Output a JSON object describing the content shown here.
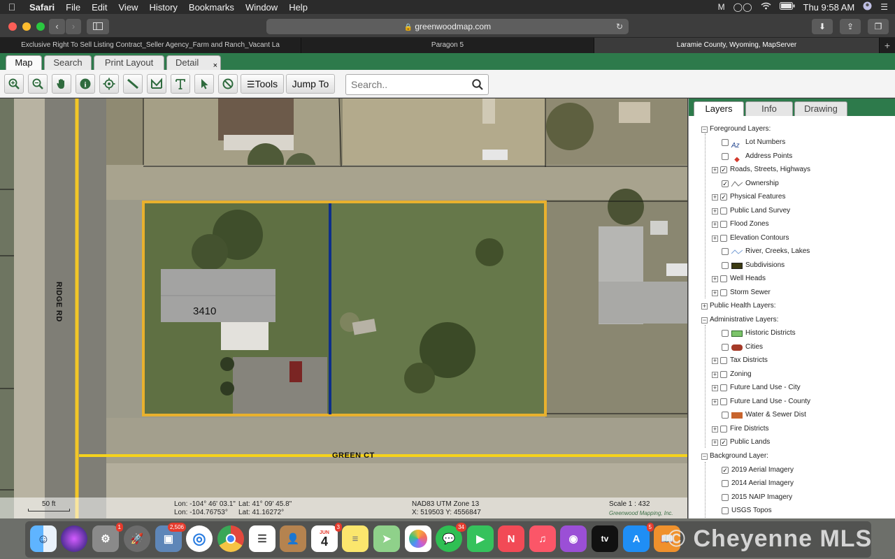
{
  "menubar": {
    "app": "Safari",
    "menus": [
      "File",
      "Edit",
      "View",
      "History",
      "Bookmarks",
      "Window",
      "Help"
    ],
    "clock": "Thu 9:58 AM",
    "status_icons": [
      "malwarebytes-icon",
      "glasses-icon",
      "wifi-icon",
      "battery-icon",
      "user-icon",
      "list-icon"
    ]
  },
  "browser": {
    "url": "greenwoodmap.com",
    "tabs": [
      {
        "title": "Exclusive Right To Sell Listing Contract_Seller Agency_Farm and Ranch_Vacant La",
        "active": false
      },
      {
        "title": "Paragon 5",
        "active": false
      },
      {
        "title": "Laramie County, Wyoming, MapServer",
        "active": true
      }
    ],
    "new_tab": "+"
  },
  "app_tabs": [
    "Map",
    "Search",
    "Print Layout",
    "Detail"
  ],
  "app_tab_close": "×",
  "toolbar": {
    "tools_label": "Tools",
    "jump_label": "Jump To",
    "search_placeholder": "Search.."
  },
  "map": {
    "street_vertical": "RIDGE RD",
    "street_horizontal": "GREEN CT",
    "address": "3410",
    "footer": {
      "lon_dms": "Lon: -104° 46' 03.1\"",
      "lat_dms": "Lat: 41° 09' 45.8\"",
      "lon_dec": "Lon: -104.76753°",
      "lat_dec": "Lat: 41.16272°",
      "datum": "NAD83 UTM Zone 13",
      "utm": "X: 519503 Y: 4556847",
      "scale": "Scale 1 : 432",
      "scalebar": "50 ft",
      "credit": "Greenwood Mapping, Inc."
    },
    "colors": {
      "parcel": "#e8b12e",
      "lot_divider": "#0d2f8a",
      "road": "#f5d21c"
    }
  },
  "panel": {
    "tabs": [
      "Layers",
      "Info",
      "Drawing"
    ],
    "groups": [
      {
        "label": "Foreground Layers:",
        "items": [
          {
            "label": "Lot Numbers",
            "checked": false,
            "expandable": false,
            "legend": "az"
          },
          {
            "label": "Address Points",
            "checked": false,
            "expandable": false,
            "legend": "dot"
          },
          {
            "label": "Roads, Streets, Highways",
            "checked": true,
            "expandable": true,
            "legend": ""
          },
          {
            "label": "Ownership",
            "checked": true,
            "expandable": false,
            "legend": "line"
          },
          {
            "label": "Physical Features",
            "checked": true,
            "expandable": true,
            "legend": ""
          },
          {
            "label": "Public Land Survey",
            "checked": false,
            "expandable": true,
            "legend": ""
          },
          {
            "label": "Flood Zones",
            "checked": false,
            "expandable": true,
            "legend": ""
          },
          {
            "label": "Elevation Contours",
            "checked": false,
            "expandable": true,
            "legend": ""
          },
          {
            "label": "River, Creeks, Lakes",
            "checked": false,
            "expandable": false,
            "legend": "wave"
          },
          {
            "label": "Subdivisions",
            "checked": false,
            "expandable": false,
            "legend": "swatch-dark"
          },
          {
            "label": "Well Heads",
            "checked": false,
            "expandable": true,
            "legend": ""
          },
          {
            "label": "Storm Sewer",
            "checked": false,
            "expandable": true,
            "legend": ""
          }
        ]
      },
      {
        "label": "Public Health Layers:",
        "items": []
      },
      {
        "label": "Administrative Layers:",
        "items": [
          {
            "label": "Historic Districts",
            "checked": false,
            "expandable": false,
            "legend": "swatch-green"
          },
          {
            "label": "Cities",
            "checked": false,
            "expandable": false,
            "legend": "swatch-red"
          },
          {
            "label": "Tax Districts",
            "checked": false,
            "expandable": true,
            "legend": ""
          },
          {
            "label": "Zoning",
            "checked": false,
            "expandable": true,
            "legend": ""
          },
          {
            "label": "Future Land Use - City",
            "checked": false,
            "expandable": true,
            "legend": ""
          },
          {
            "label": "Future Land Use - County",
            "checked": false,
            "expandable": true,
            "legend": ""
          },
          {
            "label": "Water & Sewer Dist",
            "checked": false,
            "expandable": false,
            "legend": "swatch-orange"
          },
          {
            "label": "Fire Districts",
            "checked": false,
            "expandable": true,
            "legend": ""
          },
          {
            "label": "Public Lands",
            "checked": true,
            "expandable": true,
            "legend": ""
          }
        ]
      },
      {
        "label": "Background Layer:",
        "items": [
          {
            "label": "2019 Aerial Imagery",
            "checked": true,
            "expandable": false,
            "legend": ""
          },
          {
            "label": "2014 Aerial Imagery",
            "checked": false,
            "expandable": false,
            "legend": ""
          },
          {
            "label": "2015 NAIP Imagery",
            "checked": false,
            "expandable": false,
            "legend": ""
          },
          {
            "label": "USGS Topos",
            "checked": false,
            "expandable": false,
            "legend": ""
          }
        ]
      }
    ]
  },
  "dock": {
    "apps": [
      {
        "name": "finder",
        "badge": ""
      },
      {
        "name": "siri",
        "badge": ""
      },
      {
        "name": "system-preferences",
        "badge": "1"
      },
      {
        "name": "launchpad",
        "badge": ""
      },
      {
        "name": "preview",
        "badge": "2,506"
      },
      {
        "name": "safari",
        "badge": ""
      },
      {
        "name": "chrome",
        "badge": ""
      },
      {
        "name": "reminders",
        "badge": ""
      },
      {
        "name": "contacts",
        "badge": ""
      },
      {
        "name": "calendar",
        "badge": "3"
      },
      {
        "name": "notes",
        "badge": ""
      },
      {
        "name": "maps",
        "badge": ""
      },
      {
        "name": "photos",
        "badge": ""
      },
      {
        "name": "messages",
        "badge": "34"
      },
      {
        "name": "facetime",
        "badge": ""
      },
      {
        "name": "news",
        "badge": ""
      },
      {
        "name": "music",
        "badge": ""
      },
      {
        "name": "podcasts",
        "badge": ""
      },
      {
        "name": "tv",
        "badge": ""
      },
      {
        "name": "app-store",
        "badge": "5"
      },
      {
        "name": "books",
        "badge": ""
      }
    ],
    "calendar_month": "JUN",
    "calendar_day": "4",
    "tv_label": "tv",
    "watermark": "© Cheyenne MLS"
  }
}
